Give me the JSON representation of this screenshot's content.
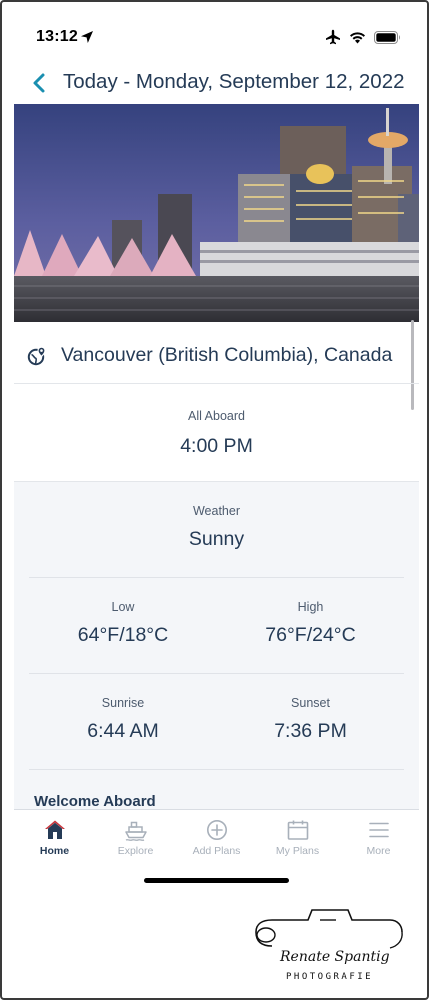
{
  "status_bar": {
    "time": "13:12",
    "icons": [
      "location-arrow-icon",
      "airplane-icon",
      "wifi-icon",
      "battery-icon"
    ]
  },
  "header": {
    "title": "Today - Monday, September 12, 2022",
    "back_icon": "chevron-left-icon"
  },
  "hero": {
    "image": "vancouver-skyline-photo"
  },
  "location": {
    "name": "Vancouver (British Columbia), Canada",
    "icon": "globe-pin-icon"
  },
  "all_aboard": {
    "label": "All Aboard",
    "value": "4:00 PM"
  },
  "weather": {
    "label": "Weather",
    "value": "Sunny"
  },
  "temperature": {
    "low_label": "Low",
    "low_value": "64°F/18°C",
    "high_label": "High",
    "high_value": "76°F/24°C"
  },
  "sun": {
    "sunrise_label": "Sunrise",
    "sunrise_value": "6:44 AM",
    "sunset_label": "Sunset",
    "sunset_value": "7:36 PM"
  },
  "welcome": {
    "title": "Welcome Aboard"
  },
  "tabs": [
    {
      "label": "Home",
      "icon": "home-icon",
      "active": true
    },
    {
      "label": "Explore",
      "icon": "ship-icon",
      "active": false
    },
    {
      "label": "Add Plans",
      "icon": "plus-circle-icon",
      "active": false
    },
    {
      "label": "My Plans",
      "icon": "calendar-icon",
      "active": false
    },
    {
      "label": "More",
      "icon": "hamburger-icon",
      "active": false
    }
  ],
  "watermark": {
    "name": "Renate Spantig",
    "subtitle": "PHOTOGRAFIE"
  },
  "colors": {
    "accent": "#1a8fb0",
    "text_primary": "#253b56",
    "text_secondary": "#4d5b6e",
    "tab_inactive": "#a8b0ba",
    "panel_bg": "#f4f6f9",
    "home_icon_red": "#c7343b"
  }
}
